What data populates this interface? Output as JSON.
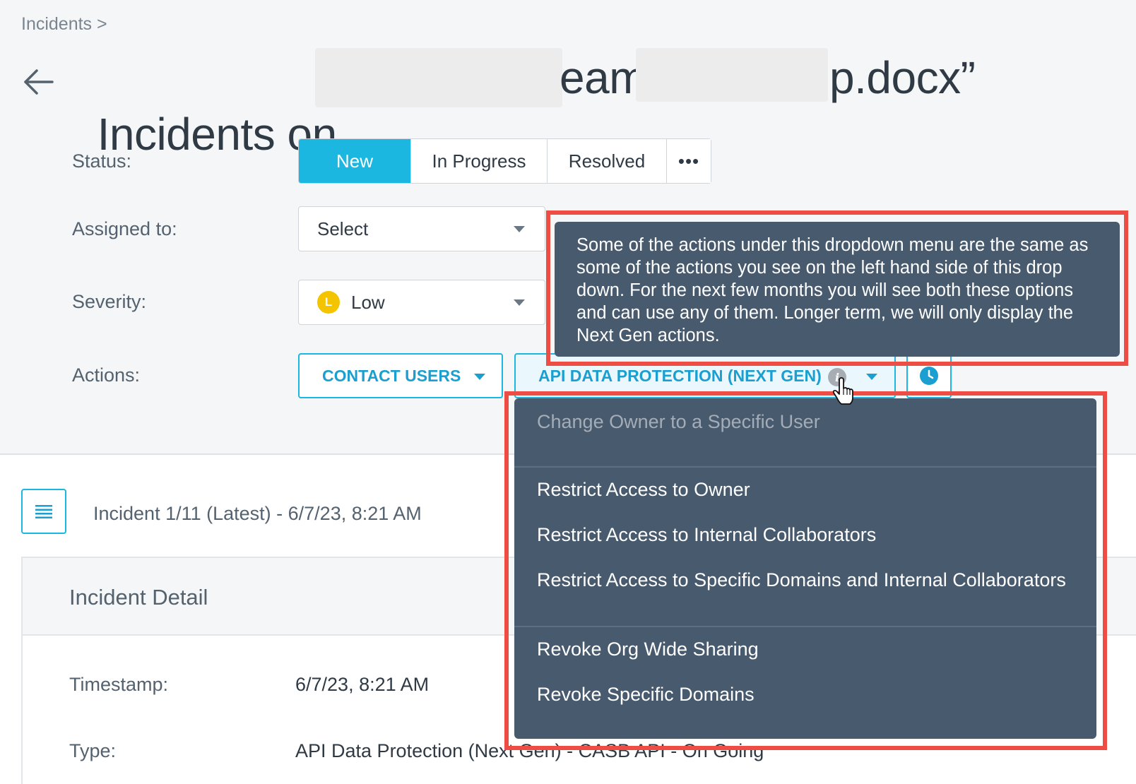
{
  "breadcrumb": "Incidents >",
  "title": {
    "prefix": "Incidents on",
    "frag1": "eam-",
    "frag2": "p.docx”"
  },
  "labels": {
    "status": "Status:",
    "assigned": "Assigned to:",
    "severity": "Severity:",
    "actions": "Actions:"
  },
  "status_tabs": [
    "New",
    "In Progress",
    "Resolved",
    "•••"
  ],
  "assigned_select": "Select",
  "severity": {
    "badge": "L",
    "value": "Low"
  },
  "actions": {
    "contact_users": "CONTACT USERS",
    "api_protection": "API DATA PROTECTION (NEXT GEN)",
    "info_glyph": "i"
  },
  "tooltip": "Some of the actions under this dropdown menu are the same as some of the actions you see on the left hand side of this drop down. For the next few months you will see both these options and can use any of them. Longer term, we will only display the Next Gen actions.",
  "menu": {
    "items": [
      "Change Owner to a Specific User",
      "Restrict Access to Owner",
      "Restrict Access to Internal Collaborators",
      "Restrict Access to Specific Domains and Internal Collaborators",
      "Revoke Org Wide Sharing",
      "Revoke Specific Domains"
    ]
  },
  "incident_nav": "Incident 1/11 (Latest) - 6/7/23, 8:21 AM",
  "detail": {
    "title": "Incident Detail",
    "timestamp_label": "Timestamp:",
    "timestamp_value": "6/7/23, 8:21 AM",
    "type_label": "Type:",
    "type_value": "API Data Protection (Next Gen) - CASB API - On Going"
  },
  "colors": {
    "accent": "#1bb7e0",
    "highlight": "#ee4d43",
    "tooltip_bg": "#485a6e",
    "severity_low": "#f5c400"
  }
}
